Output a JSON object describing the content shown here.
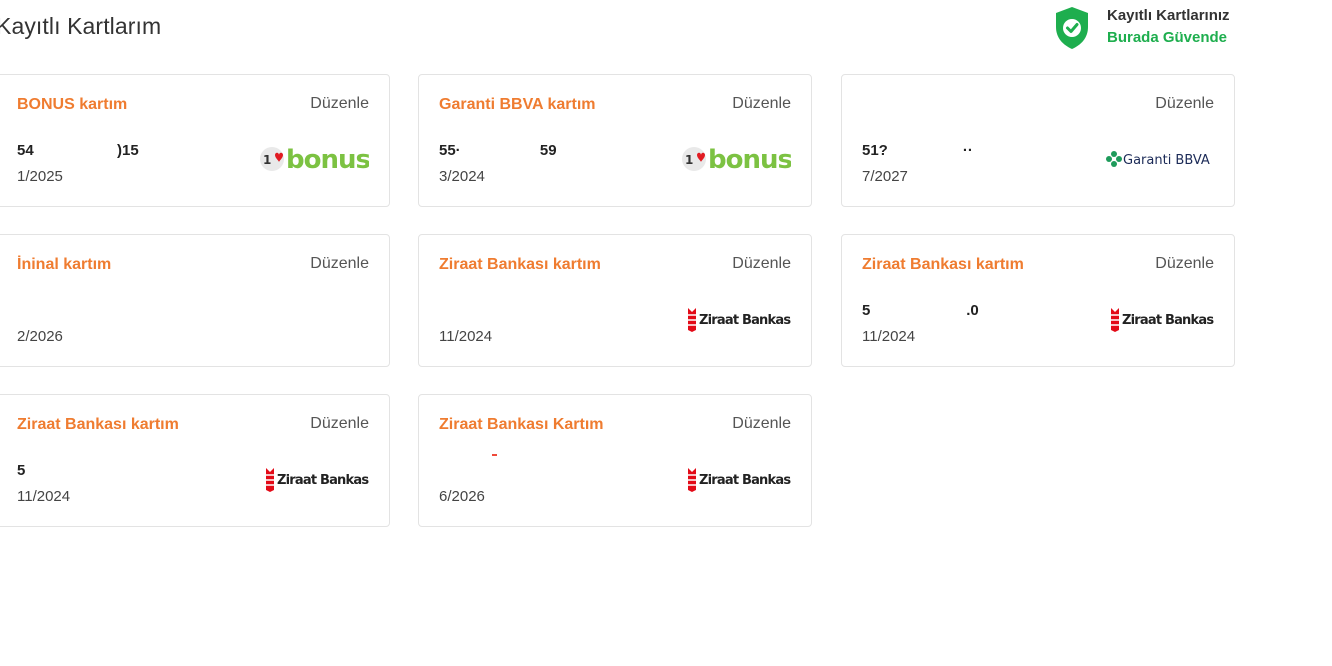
{
  "page": {
    "title": "Kayıtlı Kartlarım"
  },
  "secure_badge": {
    "line1": "Kayıtlı Kartlarınız",
    "line2": "Burada Güvende",
    "icon": "shield-check-icon"
  },
  "colors": {
    "accent_orange": "#ef7c30",
    "secure_green": "#1eae4e",
    "card_border": "#e3e3e3"
  },
  "edit_label": "Düzenle",
  "cards": [
    {
      "title": "BONUS kartım",
      "number": "54                    )15",
      "expiry": "1/2025",
      "logo": "bonus-logo",
      "logo_text": "bonus"
    },
    {
      "title": "Garanti BBVA kartım",
      "number": "55·                   59",
      "expiry": "3/2024",
      "logo": "bonus-logo",
      "logo_text": "bonus"
    },
    {
      "title": "",
      "number": "51?                  ··",
      "expiry": "7/2027",
      "logo": "garanti-bbva-logo",
      "logo_text": "Garanti BBVA"
    },
    {
      "title": "İninal kartım",
      "number": "",
      "expiry": "2/2026",
      "logo": "",
      "logo_text": ""
    },
    {
      "title": "Ziraat Bankası kartım",
      "number": "",
      "expiry": "11/2024",
      "logo": "ziraat-bankasi-logo",
      "logo_text": "Ziraat Bankası"
    },
    {
      "title": "Ziraat Bankası kartım",
      "number": "5                       .0",
      "expiry": "11/2024",
      "logo": "ziraat-bankasi-logo",
      "logo_text": "Ziraat Bankası"
    },
    {
      "title": "Ziraat Bankası kartım",
      "number": "5",
      "expiry": "11/2024",
      "logo": "ziraat-bankasi-logo",
      "logo_text": "Ziraat Bankası"
    },
    {
      "title": "Ziraat Bankası Kartım",
      "number": "",
      "expiry": "6/2026",
      "logo": "ziraat-bankasi-logo",
      "logo_text": "Ziraat Bankası"
    }
  ]
}
